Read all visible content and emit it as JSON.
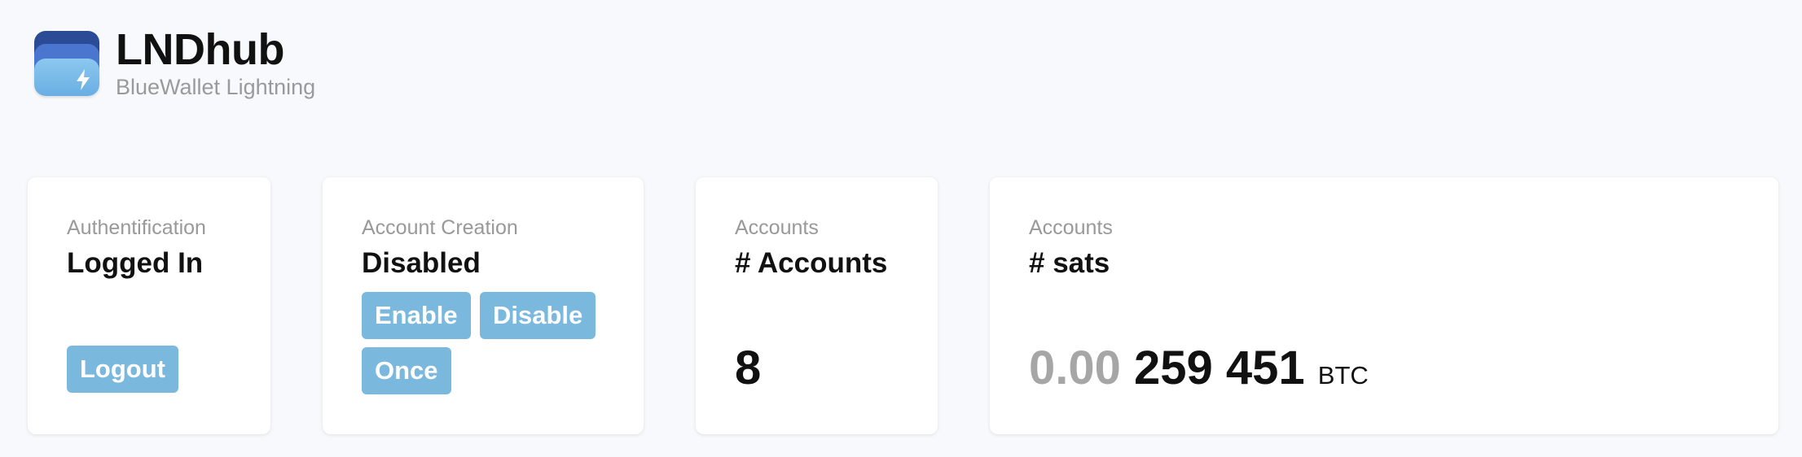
{
  "header": {
    "title": "LNDhub",
    "subtitle": "BlueWallet Lightning",
    "logo_icon": "bolt-icon"
  },
  "cards": {
    "auth": {
      "label": "Authentification",
      "value": "Logged In",
      "logout_label": "Logout"
    },
    "creation": {
      "label": "Account Creation",
      "value": "Disabled",
      "enable_label": "Enable",
      "disable_label": "Disable",
      "once_label": "Once"
    },
    "accounts": {
      "label": "Accounts",
      "value": "# Accounts",
      "count": "8"
    },
    "sats": {
      "label": "Accounts",
      "value": "# sats",
      "btc_prefix": "0.00",
      "btc_main": "259 451",
      "unit": "BTC"
    }
  },
  "colors": {
    "background": "#f8f9fc",
    "button": "#7ab8de",
    "label_gray": "#999999",
    "logo_dark": "#2b4b96",
    "logo_mid": "#4a76cf",
    "logo_light": "#8cc8ef"
  }
}
